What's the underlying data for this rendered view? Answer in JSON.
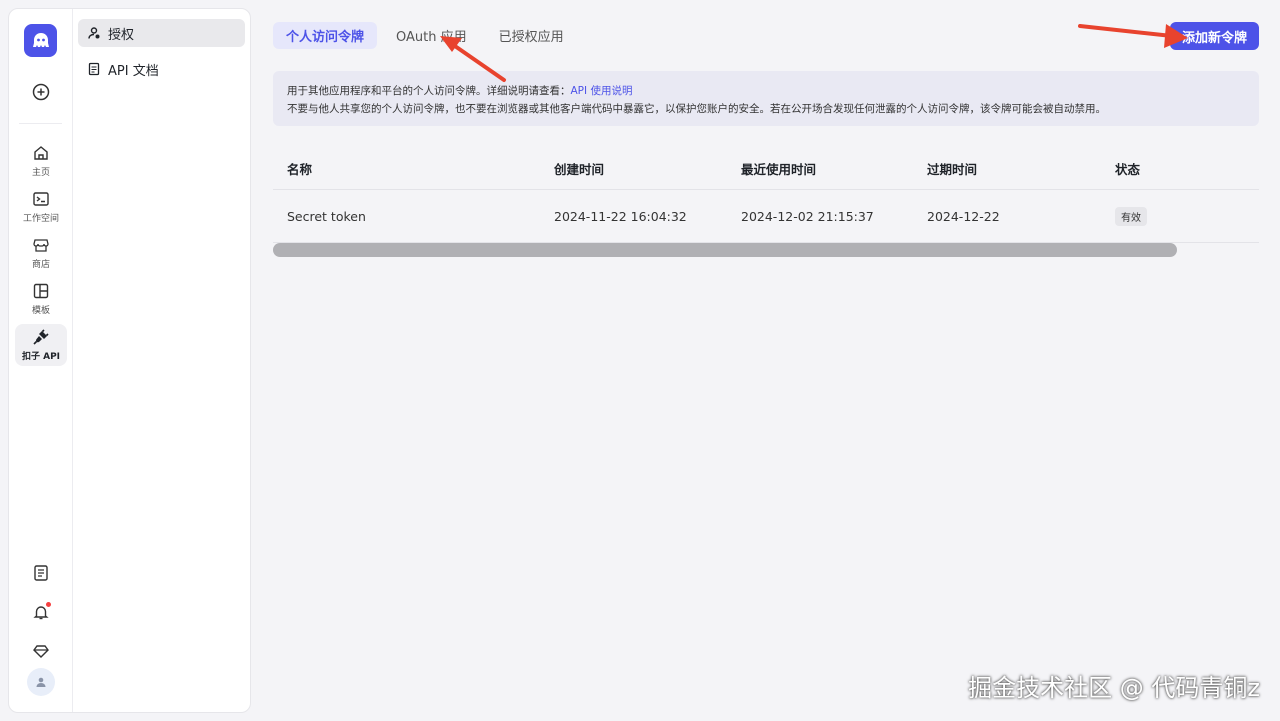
{
  "rail": {
    "items": [
      {
        "label": "主页",
        "icon": "home-icon"
      },
      {
        "label": "工作空间",
        "icon": "terminal-icon"
      },
      {
        "label": "商店",
        "icon": "store-icon"
      },
      {
        "label": "模板",
        "icon": "template-icon"
      },
      {
        "label": "扣子 API",
        "icon": "plug-icon"
      }
    ]
  },
  "subnav": {
    "items": [
      {
        "label": "授权",
        "icon": "key-icon"
      },
      {
        "label": "API 文档",
        "icon": "doc-icon"
      }
    ]
  },
  "tabs": [
    {
      "label": "个人访问令牌"
    },
    {
      "label": "OAuth 应用"
    },
    {
      "label": "已授权应用"
    }
  ],
  "add_button": "添加新令牌",
  "info": {
    "line1": "用于其他应用程序和平台的个人访问令牌。详细说明请查看：",
    "link": "API 使用说明",
    "line2": "不要与他人共享您的个人访问令牌，也不要在浏览器或其他客户端代码中暴露它，以保护您账户的安全。若在公开场合发现任何泄露的个人访问令牌，该令牌可能会被自动禁用。"
  },
  "table": {
    "headers": [
      "名称",
      "创建时间",
      "最近使用时间",
      "过期时间",
      "状态"
    ],
    "rows": [
      [
        "Secret token",
        "2024-11-22 16:04:32",
        "2024-12-02 21:15:37",
        "2024-12-22",
        "有效"
      ]
    ]
  },
  "watermark": "掘金技术社区 @ 代码青铜z",
  "colors": {
    "accent": "#4d53e8",
    "arrow": "#e8432e",
    "notification": "#f53f3f"
  }
}
